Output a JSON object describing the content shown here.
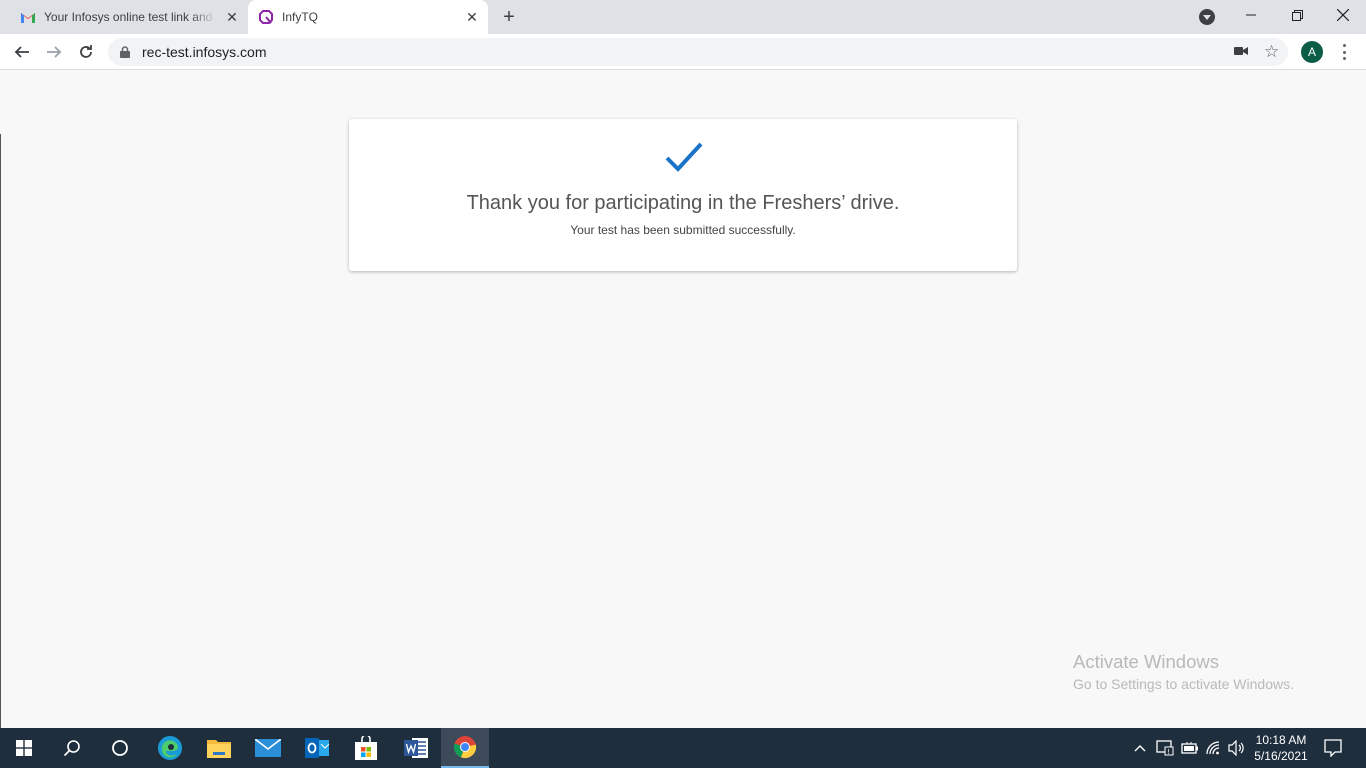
{
  "browser": {
    "tabs": [
      {
        "title": "Your Infosys online test link and I",
        "icon": "gmail-icon"
      },
      {
        "title": "InfyTQ",
        "icon": "infytq-icon",
        "active": true
      }
    ],
    "url": "rec-test.infosys.com",
    "profile_initial": "A"
  },
  "page": {
    "heading": "Thank you for participating in the Freshers’ drive.",
    "message": "Your test has been submitted successfully.",
    "accent_color": "#1a73c8"
  },
  "watermark": {
    "title": "Activate Windows",
    "subtitle": "Go to Settings to activate Windows."
  },
  "taskbar": {
    "apps": [
      "start-icon",
      "search-icon",
      "cortana-icon",
      "edge-icon",
      "file-explorer-icon",
      "mail-icon",
      "outlook-icon",
      "store-icon",
      "word-icon",
      "chrome-icon"
    ],
    "time": "10:18 AM",
    "date": "5/16/2021"
  }
}
